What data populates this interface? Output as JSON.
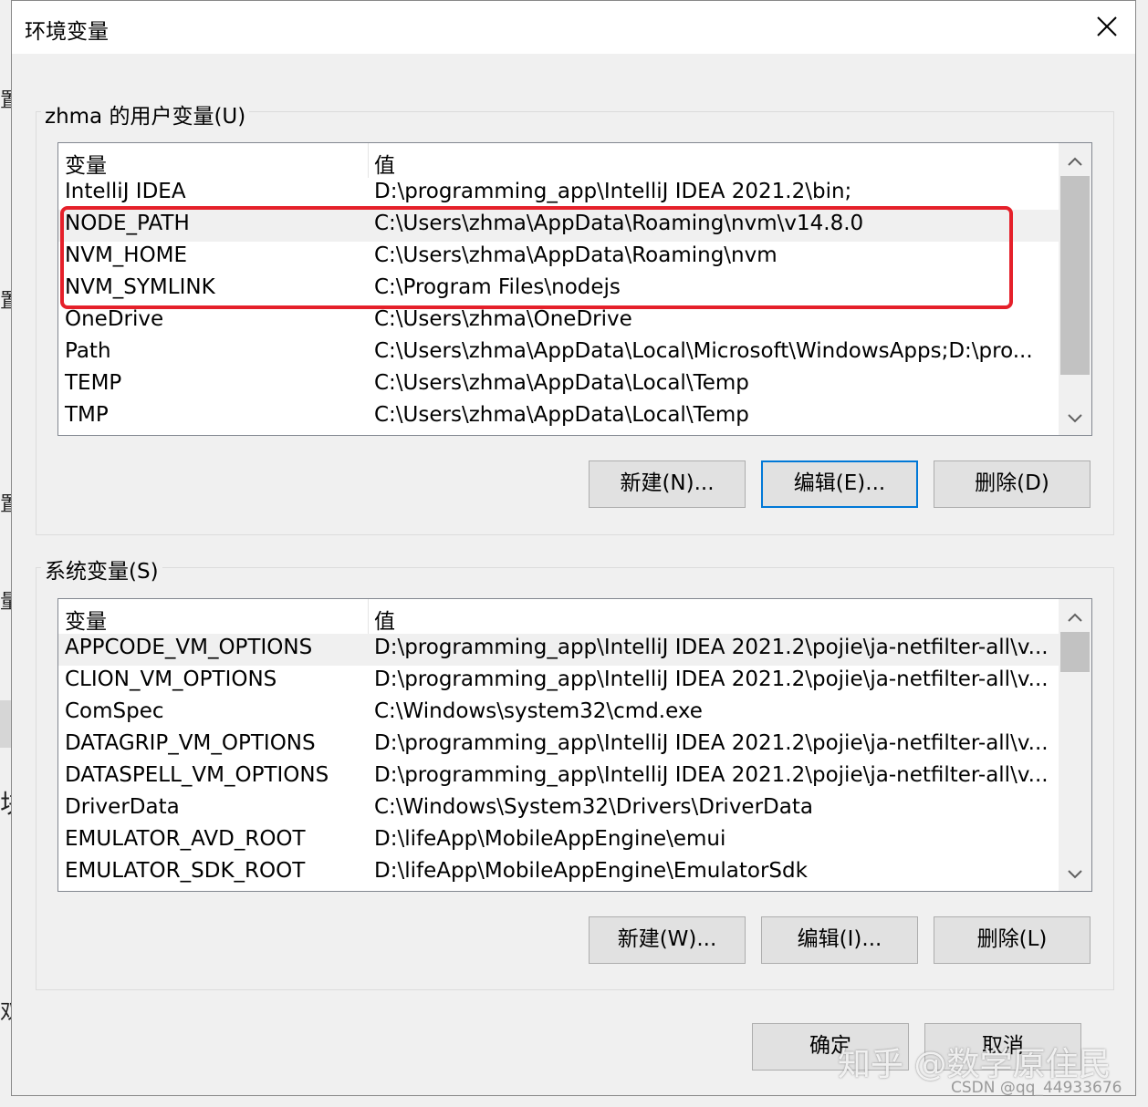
{
  "background": {
    "glyphs": [
      "置",
      "置",
      "置",
      "量(",
      "块",
      "双"
    ]
  },
  "dialog": {
    "title": "环境变量",
    "user_group": {
      "label": "zhma 的用户变量(U)",
      "columns": [
        "变量",
        "值"
      ],
      "rows": [
        {
          "name": "IntelliJ IDEA",
          "value": "D:\\programming_app\\IntelliJ IDEA 2021.2\\bin;"
        },
        {
          "name": "NODE_PATH",
          "value": "C:\\Users\\zhma\\AppData\\Roaming\\nvm\\v14.8.0"
        },
        {
          "name": "NVM_HOME",
          "value": "C:\\Users\\zhma\\AppData\\Roaming\\nvm"
        },
        {
          "name": "NVM_SYMLINK",
          "value": "C:\\Program Files\\nodejs"
        },
        {
          "name": "OneDrive",
          "value": "C:\\Users\\zhma\\OneDrive"
        },
        {
          "name": "Path",
          "value": "C:\\Users\\zhma\\AppData\\Local\\Microsoft\\WindowsApps;D:\\pro..."
        },
        {
          "name": "TEMP",
          "value": "C:\\Users\\zhma\\AppData\\Local\\Temp"
        },
        {
          "name": "TMP",
          "value": "C:\\Users\\zhma\\AppData\\Local\\Temp"
        }
      ],
      "selected_row": 1,
      "buttons": {
        "new": "新建(N)...",
        "edit": "编辑(E)...",
        "delete": "删除(D)"
      }
    },
    "system_group": {
      "label": "系统变量(S)",
      "columns": [
        "变量",
        "值"
      ],
      "rows": [
        {
          "name": "APPCODE_VM_OPTIONS",
          "value": "D:\\programming_app\\IntelliJ IDEA 2021.2\\pojie\\ja-netfilter-all\\v..."
        },
        {
          "name": "CLION_VM_OPTIONS",
          "value": "D:\\programming_app\\IntelliJ IDEA 2021.2\\pojie\\ja-netfilter-all\\v..."
        },
        {
          "name": "ComSpec",
          "value": "C:\\Windows\\system32\\cmd.exe"
        },
        {
          "name": "DATAGRIP_VM_OPTIONS",
          "value": "D:\\programming_app\\IntelliJ IDEA 2021.2\\pojie\\ja-netfilter-all\\v..."
        },
        {
          "name": "DATASPELL_VM_OPTIONS",
          "value": "D:\\programming_app\\IntelliJ IDEA 2021.2\\pojie\\ja-netfilter-all\\v..."
        },
        {
          "name": "DriverData",
          "value": "C:\\Windows\\System32\\Drivers\\DriverData"
        },
        {
          "name": "EMULATOR_AVD_ROOT",
          "value": "D:\\lifeApp\\MobileAppEngine\\emui"
        },
        {
          "name": "EMULATOR_SDK_ROOT",
          "value": "D:\\lifeApp\\MobileAppEngine\\EmulatorSdk"
        }
      ],
      "selected_row": 0,
      "buttons": {
        "new": "新建(W)...",
        "edit": "编辑(I)...",
        "delete": "删除(L)"
      }
    },
    "footer": {
      "ok": "确定",
      "cancel": "取消"
    }
  },
  "watermark": {
    "text": "知乎 @数学原住民",
    "credit": "CSDN @qq_44933676"
  },
  "colors": {
    "highlight": "#e5202a",
    "focus": "#0078d7"
  }
}
